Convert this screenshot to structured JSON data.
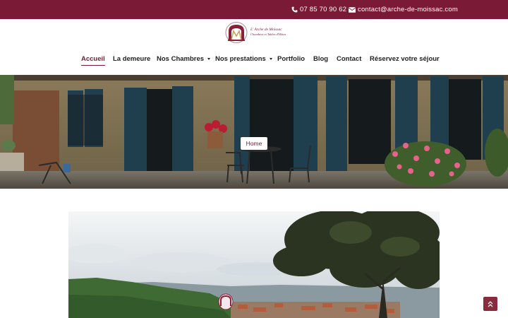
{
  "topbar": {
    "phone": "07 85 70 90 62",
    "email": "contact@arche-de-moissac.com",
    "phone_icon": "phone-icon",
    "email_icon": "envelope-icon"
  },
  "logo": {
    "line1": "L' Arche de Moissac",
    "line2": "Chambres et Tables d'Hôtes",
    "line3": ""
  },
  "nav": {
    "items": [
      {
        "label": "Accueil",
        "active": true,
        "dropdown": false
      },
      {
        "label": "La demeure",
        "active": false,
        "dropdown": false
      },
      {
        "label": "Nos Chambres",
        "active": false,
        "dropdown": true
      },
      {
        "label": "Nos prestations",
        "active": false,
        "dropdown": true
      },
      {
        "label": "Portfolio",
        "active": false,
        "dropdown": false
      },
      {
        "label": "Blog",
        "active": false,
        "dropdown": false
      },
      {
        "label": "Contact",
        "active": false,
        "dropdown": false
      },
      {
        "label": "Réservez votre séjour",
        "active": false,
        "dropdown": false
      }
    ]
  },
  "hero": {
    "breadcrumb": "Home"
  },
  "colors": {
    "brand": "#7a1a37",
    "scroll_button": "#8a2a3d"
  },
  "scroll_top_icon": "double-chevron-up-icon"
}
